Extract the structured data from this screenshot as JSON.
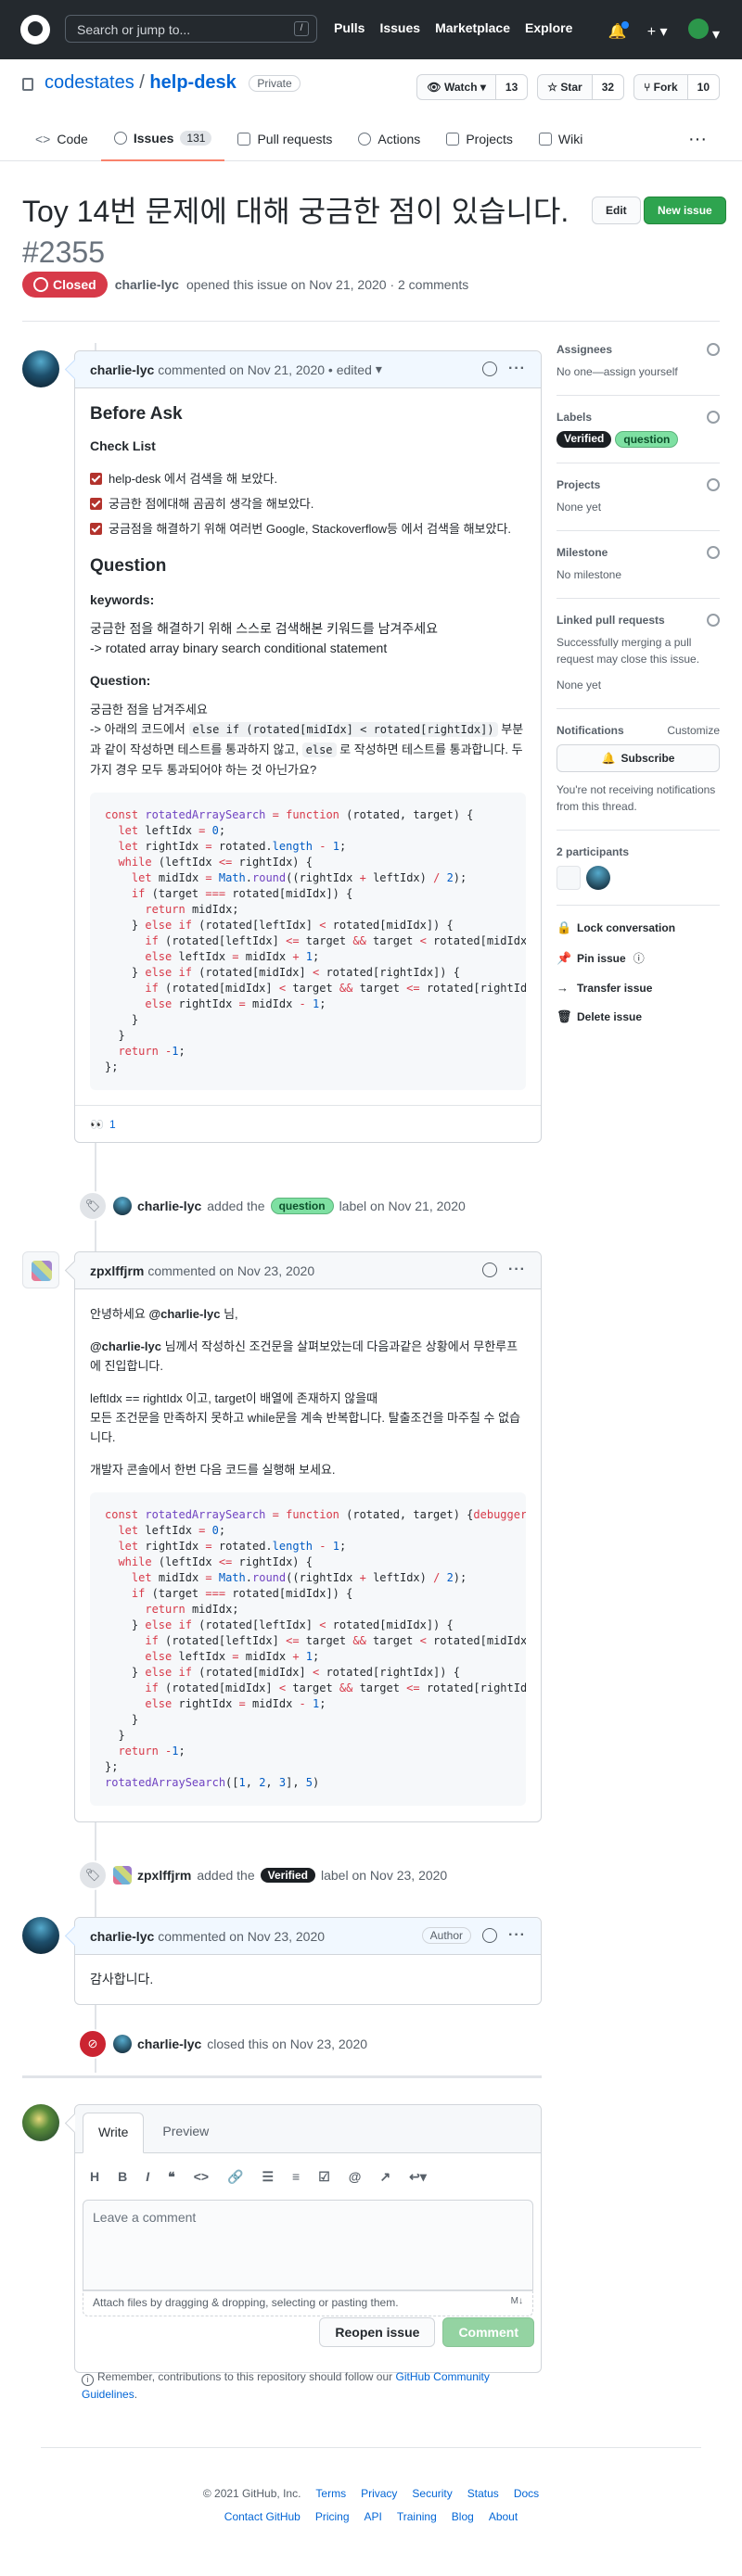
{
  "header": {
    "search_placeholder": "Search or jump to...",
    "search_kbd": "/",
    "nav": [
      "Pulls",
      "Issues",
      "Marketplace",
      "Explore"
    ]
  },
  "repo": {
    "owner": "codestates",
    "name": "help-desk",
    "visibility": "Private",
    "watch_label": "Watch",
    "watch_count": "13",
    "star_label": "Star",
    "star_count": "32",
    "fork_label": "Fork",
    "fork_count": "10"
  },
  "tabs": [
    {
      "label": "Code"
    },
    {
      "label": "Issues",
      "count": "131"
    },
    {
      "label": "Pull requests"
    },
    {
      "label": "Actions"
    },
    {
      "label": "Projects"
    },
    {
      "label": "Wiki"
    }
  ],
  "issue": {
    "title": "Toy 14번 문제에 대해 궁금한 점이 있습니다.",
    "number": "#2355",
    "status": "Closed",
    "author": "charlie-lyc",
    "opened_text": "opened this issue on Nov 21, 2020 · 2 comments",
    "edit_label": "Edit",
    "new_issue_label": "New issue"
  },
  "comment1": {
    "author": "charlie-lyc",
    "meta": "commented on Nov 21, 2020 • edited",
    "h_before": "Before Ask",
    "h_checklist": "Check List",
    "checks": [
      "help-desk 에서 검색을 해 보았다.",
      "궁금한 점에대해 곰곰히 생각을 해보았다.",
      "궁금점을 해결하기 위해 여러번 Google, Stackoverflow등 에서 검색을 해보았다."
    ],
    "h_question": "Question",
    "keywords_label": "keywords:",
    "keywords_l1": "궁금한 점을 해결하기 위해 스스로 검색해본 키워드를 남겨주세요",
    "keywords_l2": "-> rotated array binary search conditional statement",
    "question_label": "Question:",
    "q_l1": "궁금한 점을 남겨주세요",
    "q_l2a": "-> 아래의 코드에서",
    "q_code1": "else if (rotated[midIdx] < rotated[rightIdx])",
    "q_l2b": "부분과 같이 작성하면 테스트를 통과하지 않고,",
    "q_code2": "else",
    "q_l2c": "로 작성하면 테스트를 통과합니다. 두가지 경우 모두 통과되어야 하는 것 아닌가요?",
    "reaction_emoji": "👀",
    "reaction_count": "1"
  },
  "event1": {
    "actor": "charlie-lyc",
    "pre": "added the",
    "label": "question",
    "post": "label on Nov 21, 2020"
  },
  "comment2": {
    "author": "zpxlffjrm",
    "meta": "commented on Nov 23, 2020",
    "greet_a": "안녕하세요",
    "greet_mention": "@charlie-lyc",
    "greet_b": "님,",
    "p1_mention": "@charlie-lyc",
    "p1": "님께서 작성하신 조건문을 살펴보았는데 다음과같은 상황에서 무한루프에 진입합니다.",
    "p2_l1": "leftIdx == rightIdx 이고, target이 배열에 존재하지 않을때",
    "p2_l2": "모든 조건문을 만족하지 못하고 while문을 계속 반복합니다. 탈출조건을 마주칠 수 없습니다.",
    "p3": "개발자 콘솔에서 한번 다음 코드를 실행해 보세요."
  },
  "event2": {
    "actor": "zpxlffjrm",
    "pre": "added the",
    "label": "Verified",
    "post": "label on Nov 23, 2020"
  },
  "comment3": {
    "author": "charlie-lyc",
    "meta": "commented on Nov 23, 2020",
    "badge": "Author",
    "body": "감사합니다."
  },
  "event3": {
    "actor": "charlie-lyc",
    "text": "closed this on Nov 23, 2020"
  },
  "sidebar": {
    "assignees_h": "Assignees",
    "assignees_v": "No one—assign yourself",
    "labels_h": "Labels",
    "labels": [
      "Verified",
      "question"
    ],
    "projects_h": "Projects",
    "projects_v": "None yet",
    "milestone_h": "Milestone",
    "milestone_v": "No milestone",
    "linked_h": "Linked pull requests",
    "linked_v": "Successfully merging a pull request may close this issue.",
    "linked_none": "None yet",
    "notif_h": "Notifications",
    "notif_customize": "Customize",
    "subscribe": "Subscribe",
    "notif_v": "You're not receiving notifications from this thread.",
    "participants_h": "2 participants",
    "actions": [
      "Lock conversation",
      "Pin issue",
      "Transfer issue",
      "Delete issue"
    ]
  },
  "newcomment": {
    "tab_write": "Write",
    "tab_preview": "Preview",
    "placeholder": "Leave a comment",
    "attach": "Attach files by dragging & dropping, selecting or pasting them.",
    "reopen": "Reopen issue",
    "comment": "Comment",
    "reminder_a": "Remember, contributions to this repository should follow our",
    "reminder_link": "GitHub Community Guidelines",
    "reminder_b": "."
  },
  "footer": {
    "copyright": "© 2021 GitHub, Inc.",
    "row1": [
      "Terms",
      "Privacy",
      "Security",
      "Status",
      "Docs"
    ],
    "row2": [
      "Contact GitHub",
      "Pricing",
      "API",
      "Training",
      "Blog",
      "About"
    ]
  },
  "colors": {
    "closed": "#d73a49",
    "new_issue": "#2ea44f",
    "link": "#0366d6"
  }
}
